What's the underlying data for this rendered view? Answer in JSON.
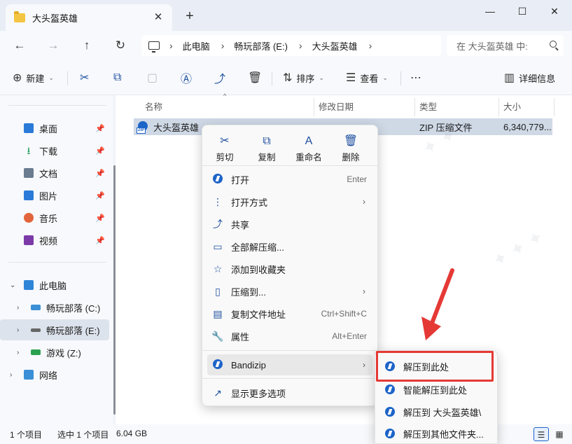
{
  "window": {
    "tab_title": "大头盔英雄",
    "new_tab": "+",
    "minimize": "—",
    "maximize": "☐",
    "close": "✕"
  },
  "nav": {
    "back": "←",
    "forward": "→",
    "up": "↑",
    "refresh": "↻"
  },
  "address": {
    "crumbs": [
      "此电脑",
      "畅玩部落 (E:)",
      "大头盔英雄"
    ],
    "sep": "›"
  },
  "search": {
    "placeholder": "在 大头盔英雄 中:"
  },
  "toolbar": {
    "new_label": "新建",
    "sort_label": "排序",
    "view_label": "查看",
    "details_label": "详细信息"
  },
  "sidebar": {
    "quick": [
      {
        "label": "桌面",
        "color": "#2a7ad8"
      },
      {
        "label": "下载",
        "color": "#1a9a55"
      },
      {
        "label": "文档",
        "color": "#6b7b90"
      },
      {
        "label": "图片",
        "color": "#2a7ad8"
      },
      {
        "label": "音乐",
        "color": "#e2643c"
      },
      {
        "label": "视频",
        "color": "#7c3aa8"
      }
    ],
    "pin": "📌",
    "this_pc": "此电脑",
    "drives": [
      {
        "label": "畅玩部落 (C:)"
      },
      {
        "label": "畅玩部落 (E:)"
      },
      {
        "label": "游戏 (Z:)"
      }
    ],
    "network": "网络"
  },
  "columns": {
    "name": "名称",
    "modified": "修改日期",
    "type": "类型",
    "size": "大小"
  },
  "file": {
    "name": "大头盔英雄",
    "type": "ZIP 压缩文件",
    "size": "6,340,779..."
  },
  "context_menu": {
    "top_actions": [
      {
        "label": "剪切",
        "icon": "✂"
      },
      {
        "label": "复制",
        "icon": "⧉"
      },
      {
        "label": "重命名",
        "icon": "A"
      },
      {
        "label": "删除",
        "icon": "🗑"
      }
    ],
    "items": [
      {
        "label": "打开",
        "shortcut": "Enter",
        "icon": "bandizip-icon"
      },
      {
        "label": "打开方式",
        "shortcut": "",
        "arrow": "›",
        "icon": "⋮"
      },
      {
        "label": "共享",
        "shortcut": "",
        "icon": "⤴"
      },
      {
        "label": "全部解压缩...",
        "shortcut": "",
        "icon": "▭"
      },
      {
        "label": "添加到收藏夹",
        "shortcut": "",
        "icon": "☆"
      },
      {
        "label": "压缩到...",
        "shortcut": "",
        "arrow": "›",
        "icon": "▯"
      },
      {
        "label": "复制文件地址",
        "shortcut": "Ctrl+Shift+C",
        "icon": "▤"
      },
      {
        "label": "属性",
        "shortcut": "Alt+Enter",
        "icon": "🔧"
      }
    ],
    "bandizip": {
      "label": "Bandizip",
      "arrow": "›"
    },
    "more": {
      "label": "显示更多选项",
      "icon": "↗"
    }
  },
  "submenu": {
    "items": [
      "解压到此处",
      "智能解压到此处",
      "解压到 大头盔英雄\\",
      "解压到其他文件夹..."
    ]
  },
  "status": {
    "count": "1 个项目",
    "selected": "选中 1 个项目",
    "size": "6.04 GB"
  },
  "colors": {
    "accent": "#1d64c8",
    "highlight": "#e53935"
  }
}
